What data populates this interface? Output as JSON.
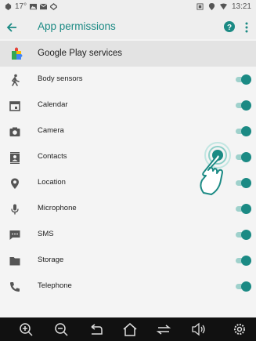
{
  "status_bar": {
    "time": "13:21",
    "temperature": "17°",
    "icons_left": [
      "notification-icon",
      "gallery-icon",
      "mail-icon",
      "cast-icon"
    ],
    "icons_right": [
      "sim-icon",
      "location-icon",
      "wifi-icon"
    ]
  },
  "app_bar": {
    "title": "App permissions",
    "back_icon": "arrow-back-icon",
    "help_icon": "help-icon",
    "more_icon": "more-vert-icon"
  },
  "app": {
    "name": "Google Play services",
    "icon": "puzzle-icon"
  },
  "permissions": [
    {
      "label": "Body sensors",
      "icon": "body-sensors-icon",
      "enabled": true
    },
    {
      "label": "Calendar",
      "icon": "calendar-icon",
      "enabled": true
    },
    {
      "label": "Camera",
      "icon": "camera-icon",
      "enabled": true
    },
    {
      "label": "Contacts",
      "icon": "contacts-icon",
      "enabled": true
    },
    {
      "label": "Location",
      "icon": "location-icon",
      "enabled": true
    },
    {
      "label": "Microphone",
      "icon": "microphone-icon",
      "enabled": true
    },
    {
      "label": "SMS",
      "icon": "sms-icon",
      "enabled": true
    },
    {
      "label": "Storage",
      "icon": "folder-icon",
      "enabled": true
    },
    {
      "label": "Telephone",
      "icon": "phone-icon",
      "enabled": true
    }
  ],
  "nav_bar": {
    "buttons": [
      "zoom-in-icon",
      "zoom-out-icon",
      "back-icon",
      "home-icon",
      "recents-icon",
      "volume-icon",
      "settings-icon"
    ]
  },
  "colors": {
    "accent": "#1b8a84",
    "track_on": "#9fd1cc",
    "app_bar_bg": "#eeeeee",
    "page_bg": "#f4f4f4",
    "nav_bg": "#111111"
  }
}
